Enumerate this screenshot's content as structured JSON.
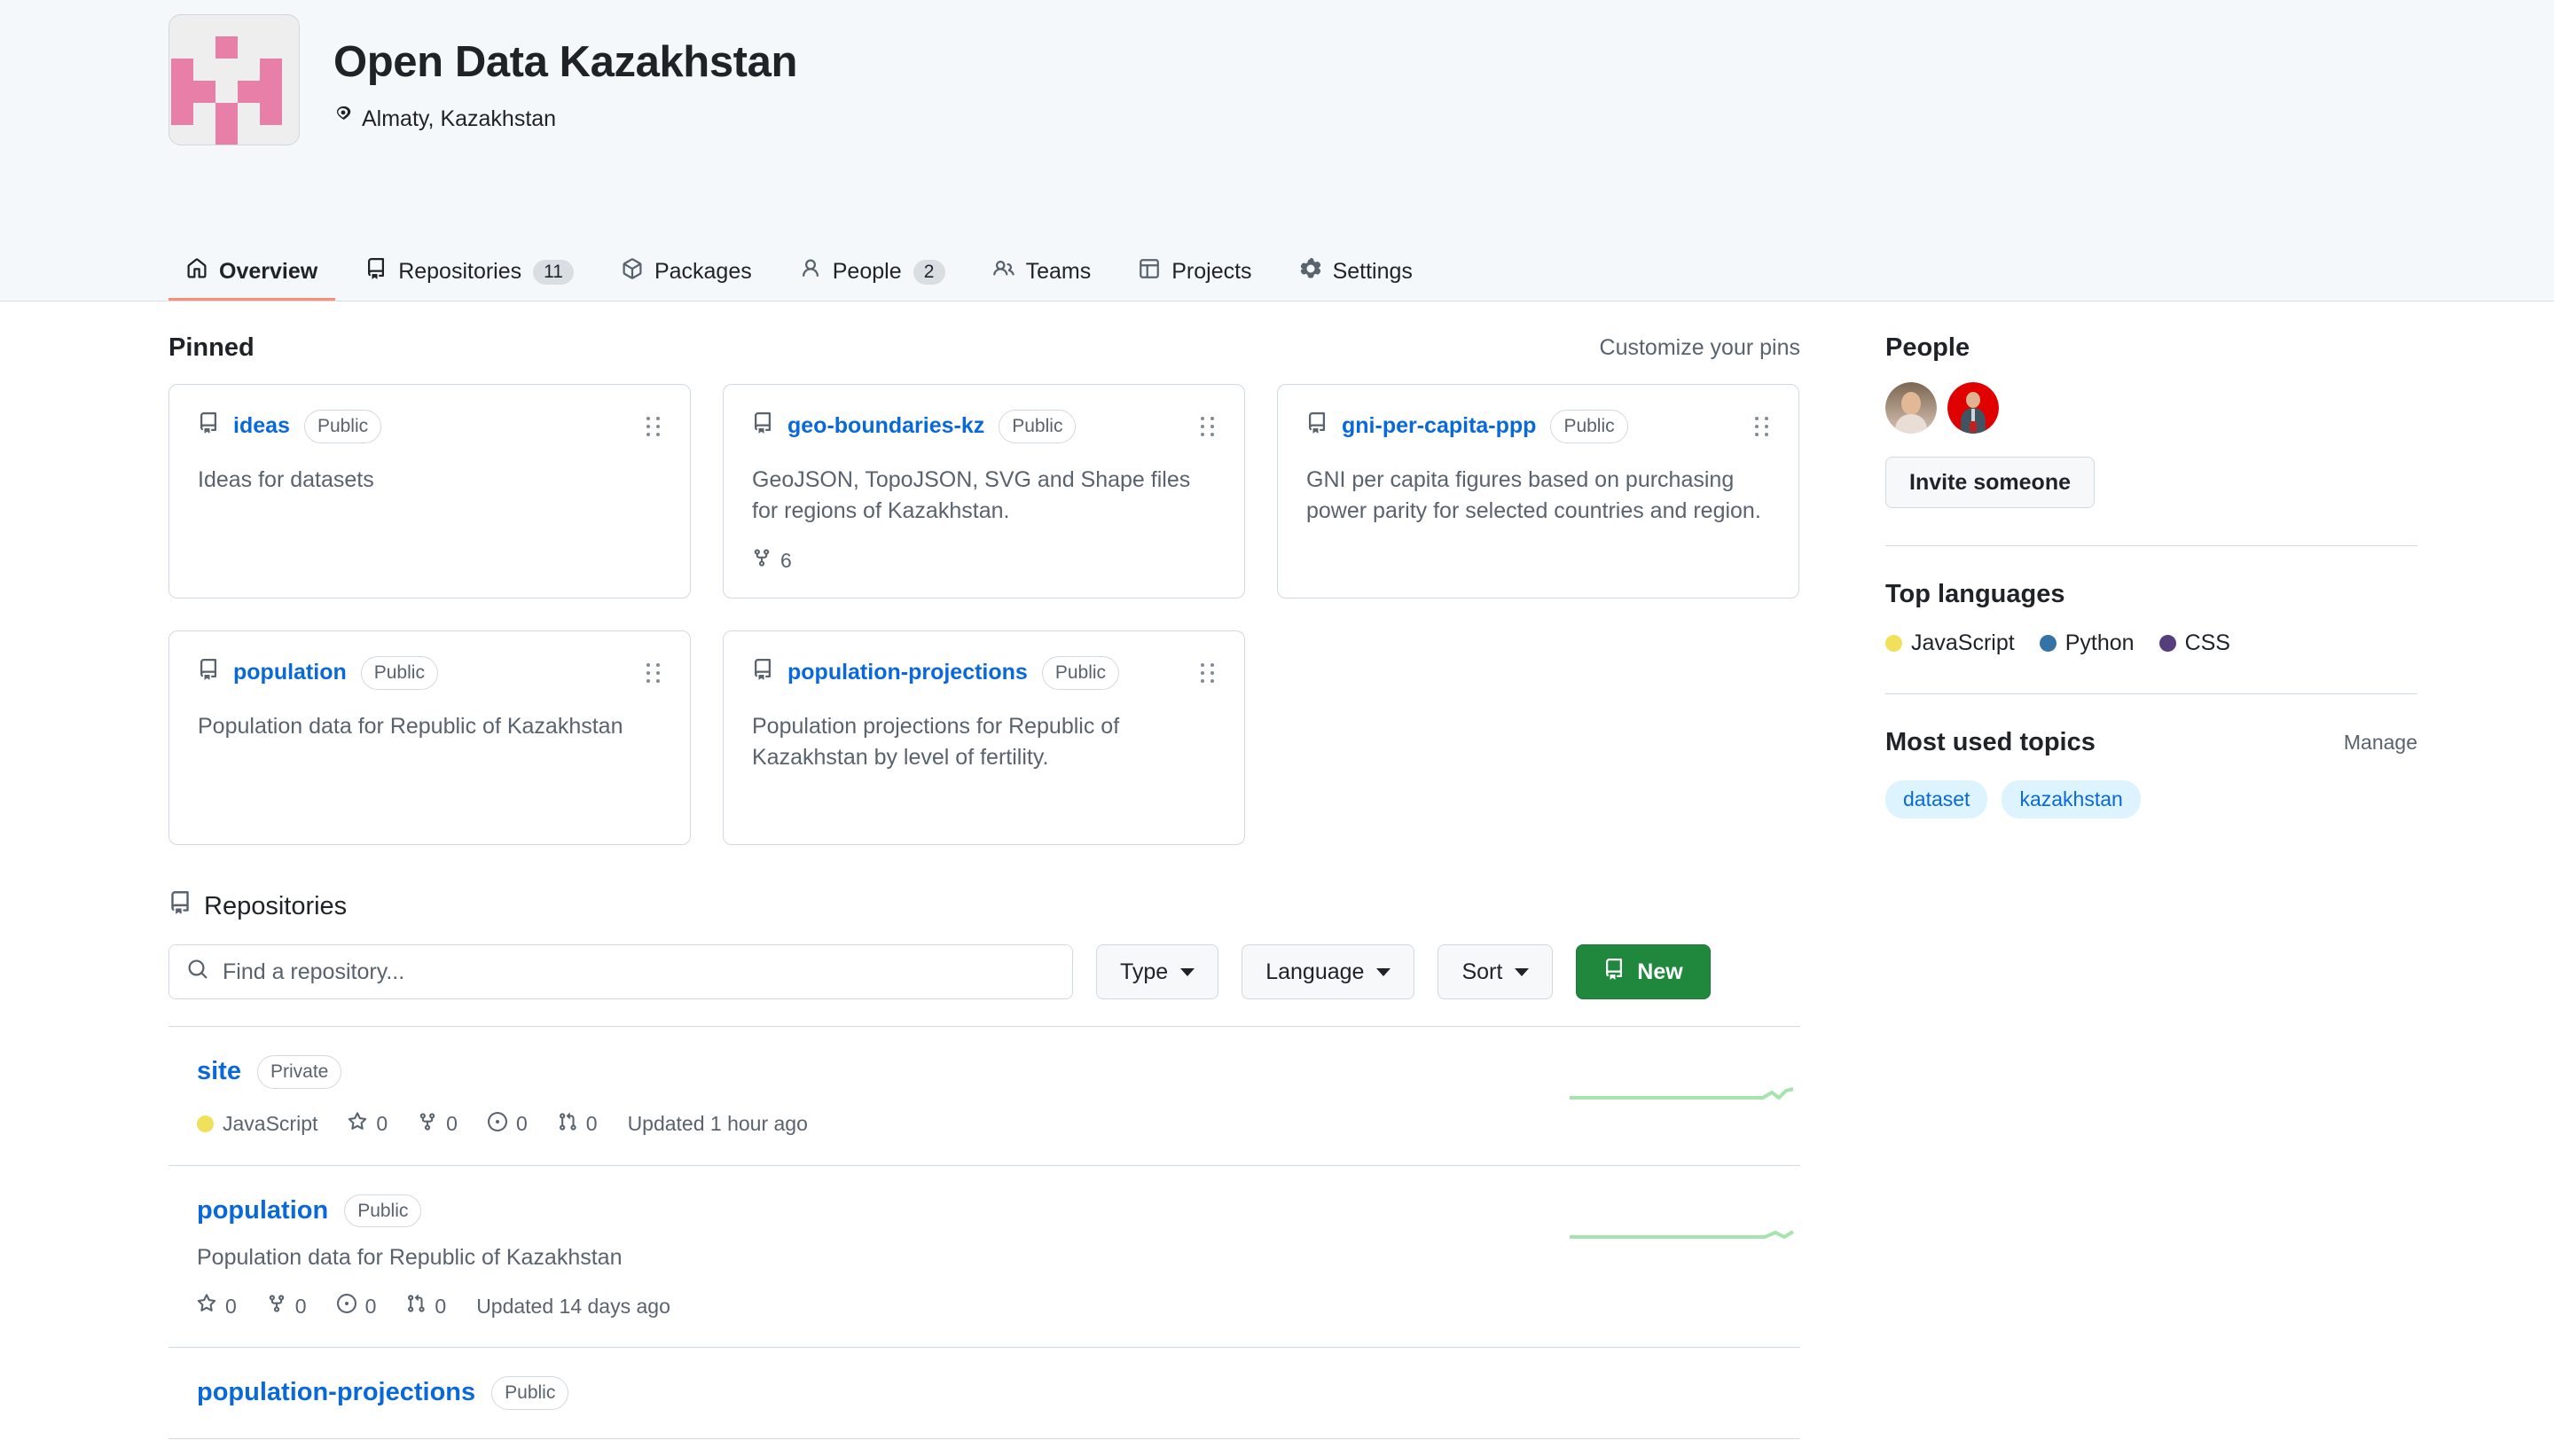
{
  "org": {
    "name": "Open Data Kazakhstan",
    "location": "Almaty, Kazakhstan",
    "location_icon": "location-pin-icon",
    "avatar_icon": "org-logo-icon",
    "avatar_color": "#e77fa8"
  },
  "nav": {
    "tabs": [
      {
        "label": "Overview",
        "icon": "home-icon",
        "count": "",
        "active": true
      },
      {
        "label": "Repositories",
        "icon": "repo-icon",
        "count": "11",
        "active": false
      },
      {
        "label": "Packages",
        "icon": "package-icon",
        "count": "",
        "active": false
      },
      {
        "label": "People",
        "icon": "person-icon",
        "count": "2",
        "active": false
      },
      {
        "label": "Teams",
        "icon": "people-icon",
        "count": "",
        "active": false
      },
      {
        "label": "Projects",
        "icon": "project-icon",
        "count": "",
        "active": false
      },
      {
        "label": "Settings",
        "icon": "gear-icon",
        "count": "",
        "active": false
      }
    ]
  },
  "pinned": {
    "title": "Pinned",
    "customize_label": "Customize your pins",
    "cards": [
      {
        "name": "ideas",
        "visibility": "Public",
        "description": "Ideas for datasets",
        "forks": ""
      },
      {
        "name": "geo-boundaries-kz",
        "visibility": "Public",
        "description": "GeoJSON, TopoJSON, SVG and Shape files for regions of Kazakhstan.",
        "forks": "6"
      },
      {
        "name": "gni-per-capita-ppp",
        "visibility": "Public",
        "description": "GNI per capita figures based on purchasing power parity for selected countries and region.",
        "forks": ""
      },
      {
        "name": "population",
        "visibility": "Public",
        "description": "Population data for Republic of Kazakhstan",
        "forks": ""
      },
      {
        "name": "population-projections",
        "visibility": "Public",
        "description": "Population projections for Republic of Kazakhstan by level of fertility.",
        "forks": ""
      }
    ]
  },
  "repositories": {
    "heading": "Repositories",
    "heading_icon": "repo-icon",
    "search_placeholder": "Find a repository...",
    "search_value": "",
    "filters": [
      {
        "label": "Type"
      },
      {
        "label": "Language"
      },
      {
        "label": "Sort"
      }
    ],
    "new_button": "New",
    "new_button_icon": "repo-icon",
    "items": [
      {
        "name": "site",
        "visibility": "Private",
        "description": "",
        "language": "JavaScript",
        "language_color": "#f1e05a",
        "stars": "0",
        "forks": "0",
        "issues": "0",
        "pulls": "0",
        "updated": "Updated 1 hour ago",
        "sparkline": true
      },
      {
        "name": "population",
        "visibility": "Public",
        "description": "Population data for Republic of Kazakhstan",
        "language": "",
        "language_color": "",
        "stars": "0",
        "forks": "0",
        "issues": "0",
        "pulls": "0",
        "updated": "Updated 14 days ago",
        "sparkline": true
      },
      {
        "name": "population-projections",
        "visibility": "Public",
        "description": "",
        "language": "",
        "language_color": "",
        "stars": "",
        "forks": "",
        "issues": "",
        "pulls": "",
        "updated": "",
        "sparkline": false
      }
    ]
  },
  "sidebar": {
    "people": {
      "title": "People",
      "invite_label": "Invite someone",
      "avatars": [
        {
          "name": "member-avatar-1",
          "bg": "#8b7361"
        },
        {
          "name": "member-avatar-2",
          "bg": "#e00000"
        }
      ]
    },
    "languages": {
      "title": "Top languages",
      "items": [
        {
          "label": "JavaScript",
          "color": "#f1e05a"
        },
        {
          "label": "Python",
          "color": "#3572a5"
        },
        {
          "label": "CSS",
          "color": "#563d7c"
        }
      ]
    },
    "topics": {
      "title": "Most used topics",
      "manage_label": "Manage",
      "items": [
        {
          "label": "dataset"
        },
        {
          "label": "kazakhstan"
        }
      ]
    }
  }
}
